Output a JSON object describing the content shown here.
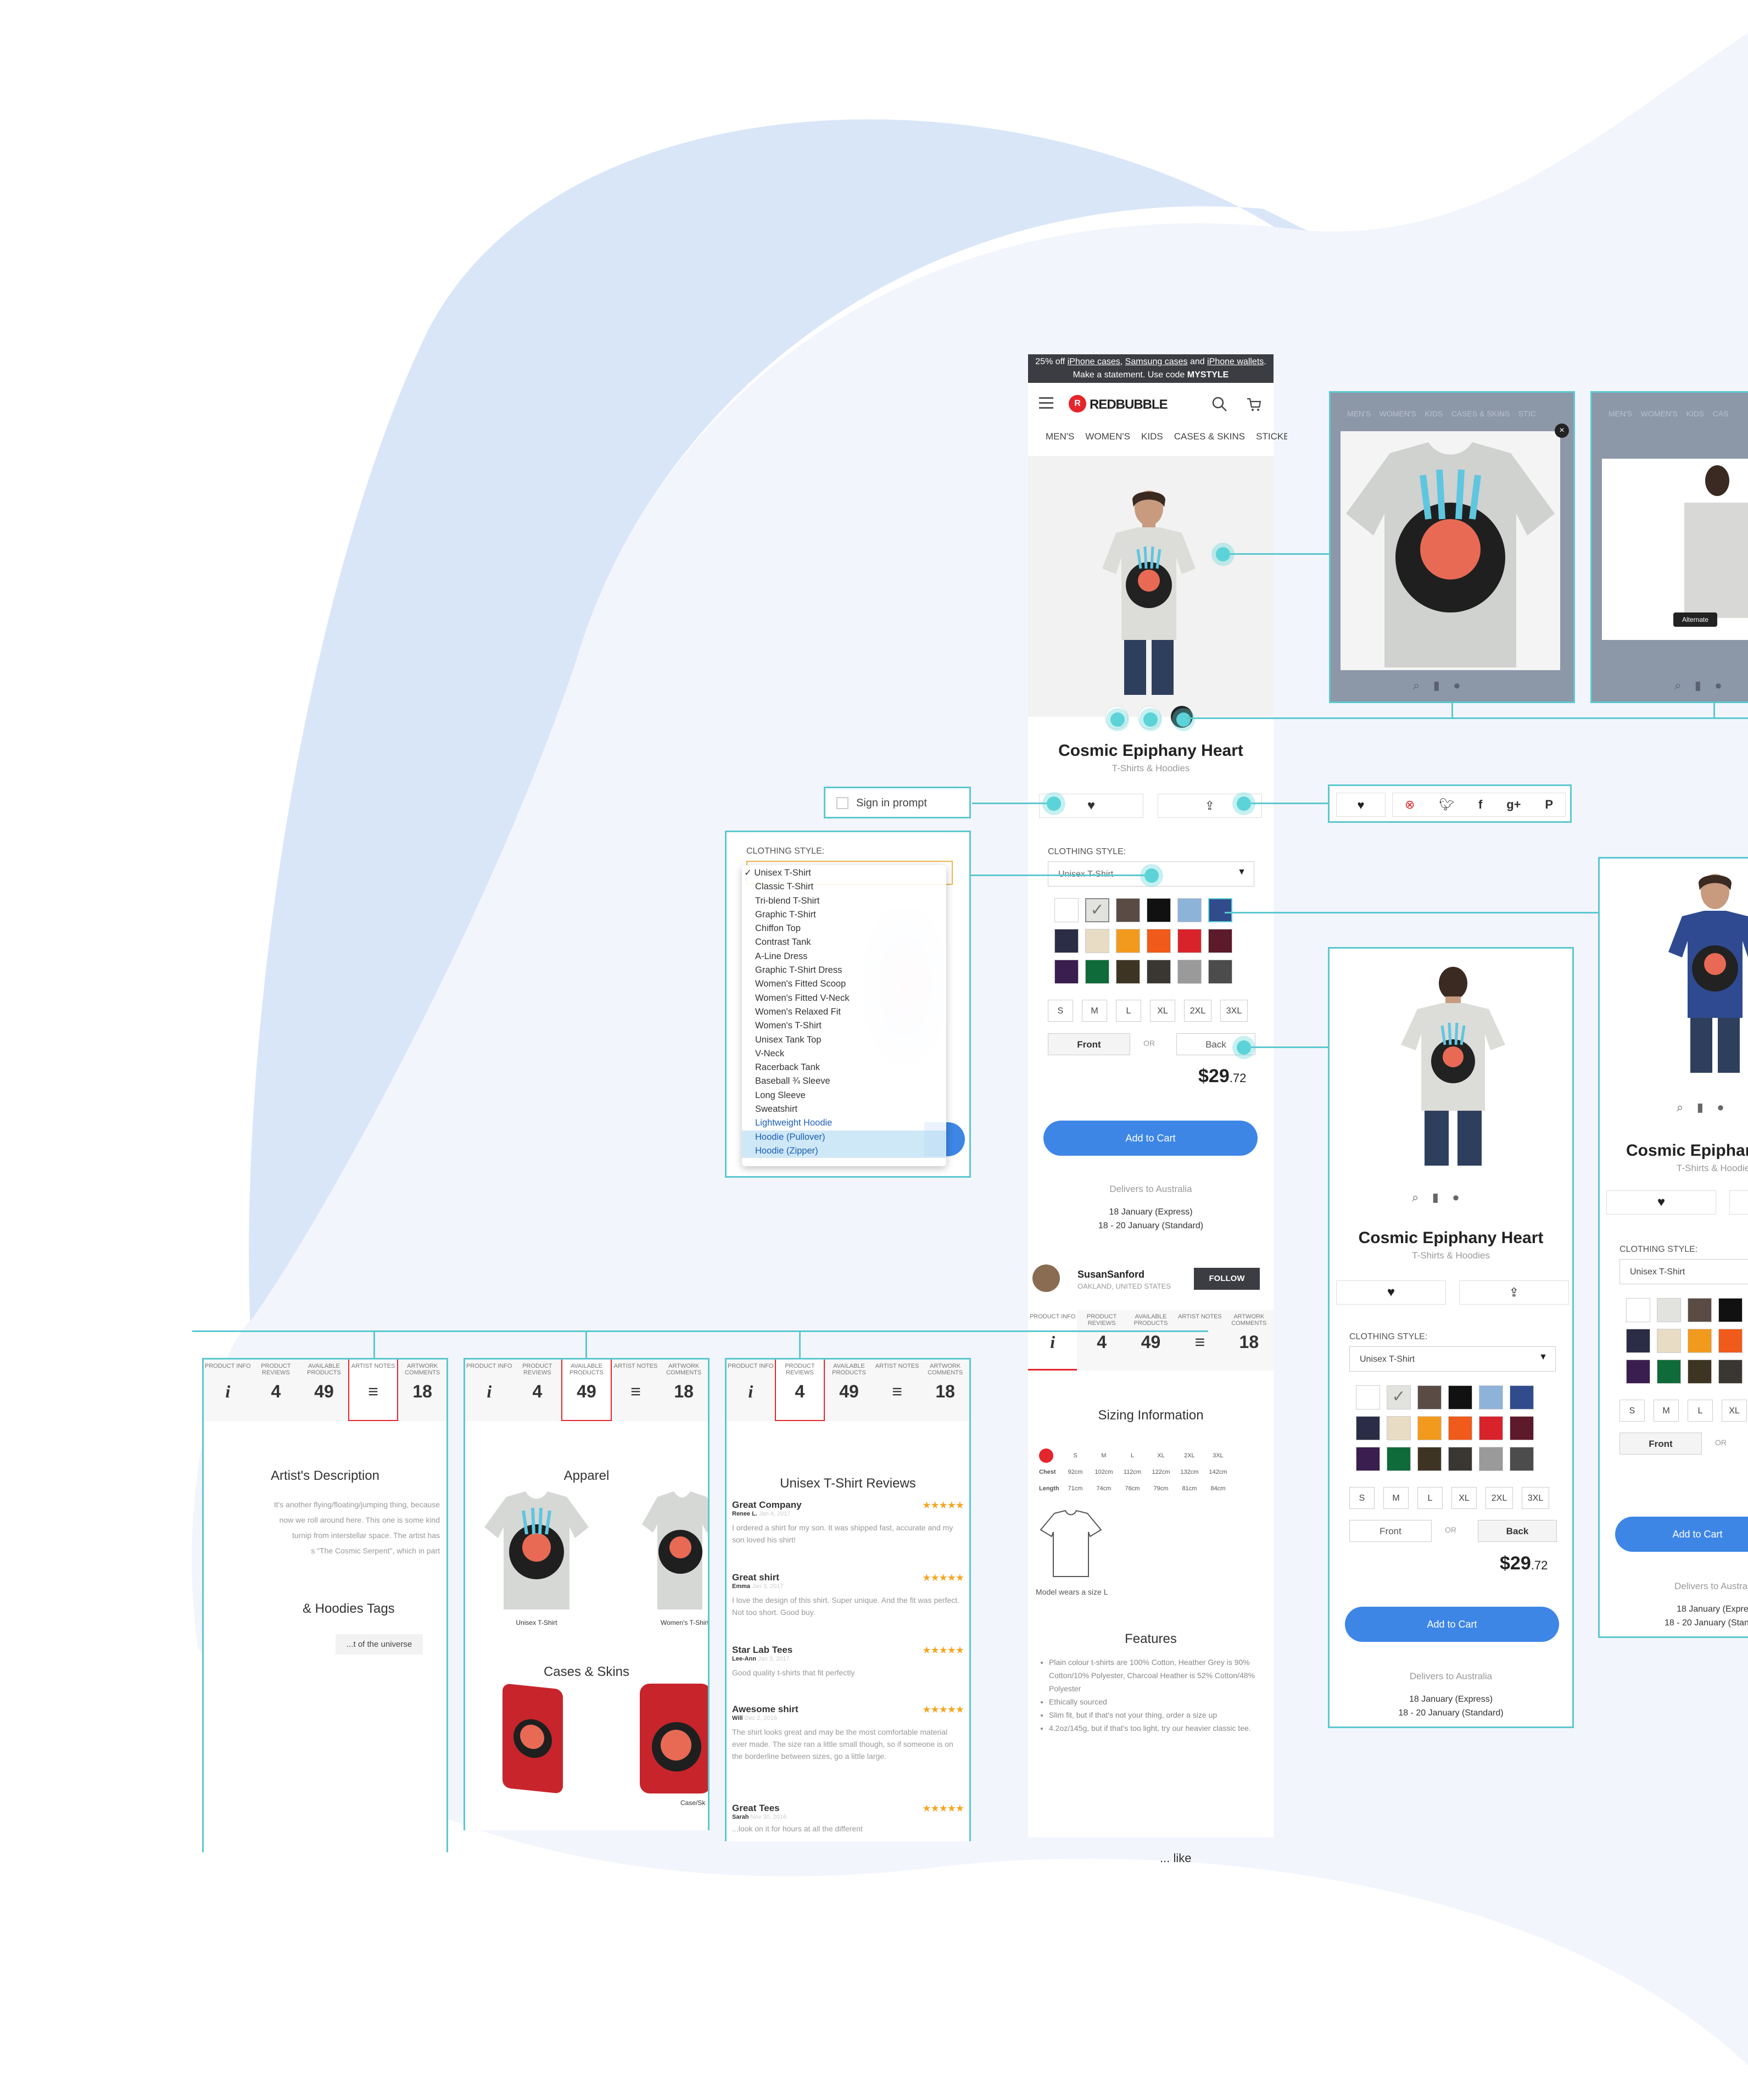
{
  "promo": {
    "part1": "25% off ",
    "link1": "iPhone cases",
    "part2": ", ",
    "link2": "Samsung cases",
    "part3": " and ",
    "link3": "iPhone wallets",
    "part4": ".",
    "line2": "Make a statement. Use code ",
    "code": "MYSTYLE"
  },
  "header": {
    "brand": "REDBUBBLE"
  },
  "nav": [
    "MEN'S",
    "WOMEN'S",
    "KIDS",
    "CASES & SKINS",
    "STICKERS"
  ],
  "product": {
    "title": "Cosmic Epiphany Heart",
    "category": "T-Shirts & Hoodies",
    "price_main": "$29",
    "price_cents": ".72"
  },
  "style": {
    "label": "CLOTHING STYLE:",
    "selected": "Unisex T-Shirt"
  },
  "sizes": [
    "S",
    "M",
    "L",
    "XL",
    "2XL",
    "3XL"
  ],
  "sides": {
    "front": "Front",
    "or": "OR",
    "back": "Back"
  },
  "cart": {
    "add": "Add to Cart"
  },
  "delivery": {
    "to": "Delivers to Australia",
    "express": "18 January (Express)",
    "standard": "18 - 20 January (Standard)"
  },
  "artist": {
    "name": "SusanSanford",
    "location": "OAKLAND, UNITED STATES",
    "follow": "FOLLOW"
  },
  "tabs": {
    "info": "PRODUCT INFO",
    "reviews": "PRODUCT REVIEWS",
    "reviews_val": "4",
    "available": "AVAILABLE PRODUCTS",
    "available_val": "49",
    "notes": "ARTIST NOTES",
    "comments": "ARTWORK COMMENTS",
    "comments_val": "18"
  },
  "sizing": {
    "title": "Sizing Information",
    "headers": [
      "S",
      "M",
      "L",
      "XL",
      "2XL",
      "3XL"
    ],
    "chest_label": "Chest",
    "chest": [
      "92cm",
      "102cm",
      "112cm",
      "122cm",
      "132cm",
      "142cm"
    ],
    "length_label": "Length",
    "length": [
      "71cm",
      "74cm",
      "76cm",
      "79cm",
      "81cm",
      "84cm"
    ],
    "model": "Model wears a size L"
  },
  "features": {
    "title": "Features",
    "items": [
      "Plain colour t-shirts are 100% Cotton, Heather Grey is 90% Cotton/10% Polyester, Charcoal Heather is 52% Cotton/48% Polyester",
      "Ethically sourced",
      "Slim fit, but if that's not your thing, order a size up",
      "4.2oz/145g, but if that's too light, try our heavier classic tee."
    ],
    "more": "... like"
  },
  "sign_in": {
    "label": "Sign in prompt"
  },
  "dropdown": {
    "label": "CLOTHING STYLE:",
    "options": [
      "Unisex T-Shirt",
      "Classic T-Shirt",
      "Tri-blend T-Shirt",
      "Graphic T-Shirt",
      "Chiffon Top",
      "Contrast Tank",
      "A-Line Dress",
      "Graphic T-Shirt Dress",
      "Women's Fitted Scoop",
      "Women's Fitted V-Neck",
      "Women's Relaxed Fit",
      "Women's T-Shirt",
      "Unisex Tank Top",
      "V-Neck",
      "Racerback Tank",
      "Baseball ¾ Sleeve",
      "Long Sleeve",
      "Sweatshirt",
      "Lightweight Hoodie",
      "Hoodie (Pullover)",
      "Hoodie (Zipper)"
    ]
  },
  "gallery": {
    "alternate": "Alternate"
  },
  "artist_desc": {
    "title": "Artist's Description",
    "lines": [
      "It's another flying/floating/jumping thing, because",
      "now we roll around here. This one is some kind",
      "turnip from interstellar space. The artist has",
      "s \"The Cosmic Serpent\", which in part"
    ],
    "tags_title": "& Hoodies Tags",
    "tag": "...t of the universe"
  },
  "apparel": {
    "title": "Apparel",
    "item1": "Unisex T-Shirt",
    "item2": "Women's T-Shirt",
    "cases_title": "Cases & Skins",
    "case_caption": "Case/Sk"
  },
  "reviews": {
    "title": "Unisex T-Shirt Reviews",
    "items": [
      {
        "title": "Great Company",
        "author": "Renee L.",
        "date": "Jan 4, 2017",
        "text": "I ordered a shirt for my son. It was shipped fast, accurate and my son loved his shirt!"
      },
      {
        "title": "Great shirt",
        "author": "Emma",
        "date": "Jan 3, 2017",
        "text": "I love the design of this shirt. Super unique. And the fit was perfect. Not too short. Good buy."
      },
      {
        "title": "Star Lab Tees",
        "author": "Lee-Ann",
        "date": "Jan 3, 2017",
        "text": "Good quality t-shirts that fit perfectly"
      },
      {
        "title": "Awesome shirt",
        "author": "Will",
        "date": "Dec 2, 2016",
        "text": "The shirt looks great and may be the most comfortable material ever made. The size ran a little small though, so if someone is on the borderline between sizes, go a little large."
      },
      {
        "title": "Great Tees",
        "author": "Sarah",
        "date": "Nov 30, 2016",
        "text": "...look on it for hours at all the different"
      }
    ],
    "stars": "★★★★★"
  },
  "colors": {
    "teal": "#5cc8cf",
    "blue_button": "#3d86e5",
    "bg_blue": "#d9e6f8",
    "bg_lavender": "#f3f5fd"
  }
}
